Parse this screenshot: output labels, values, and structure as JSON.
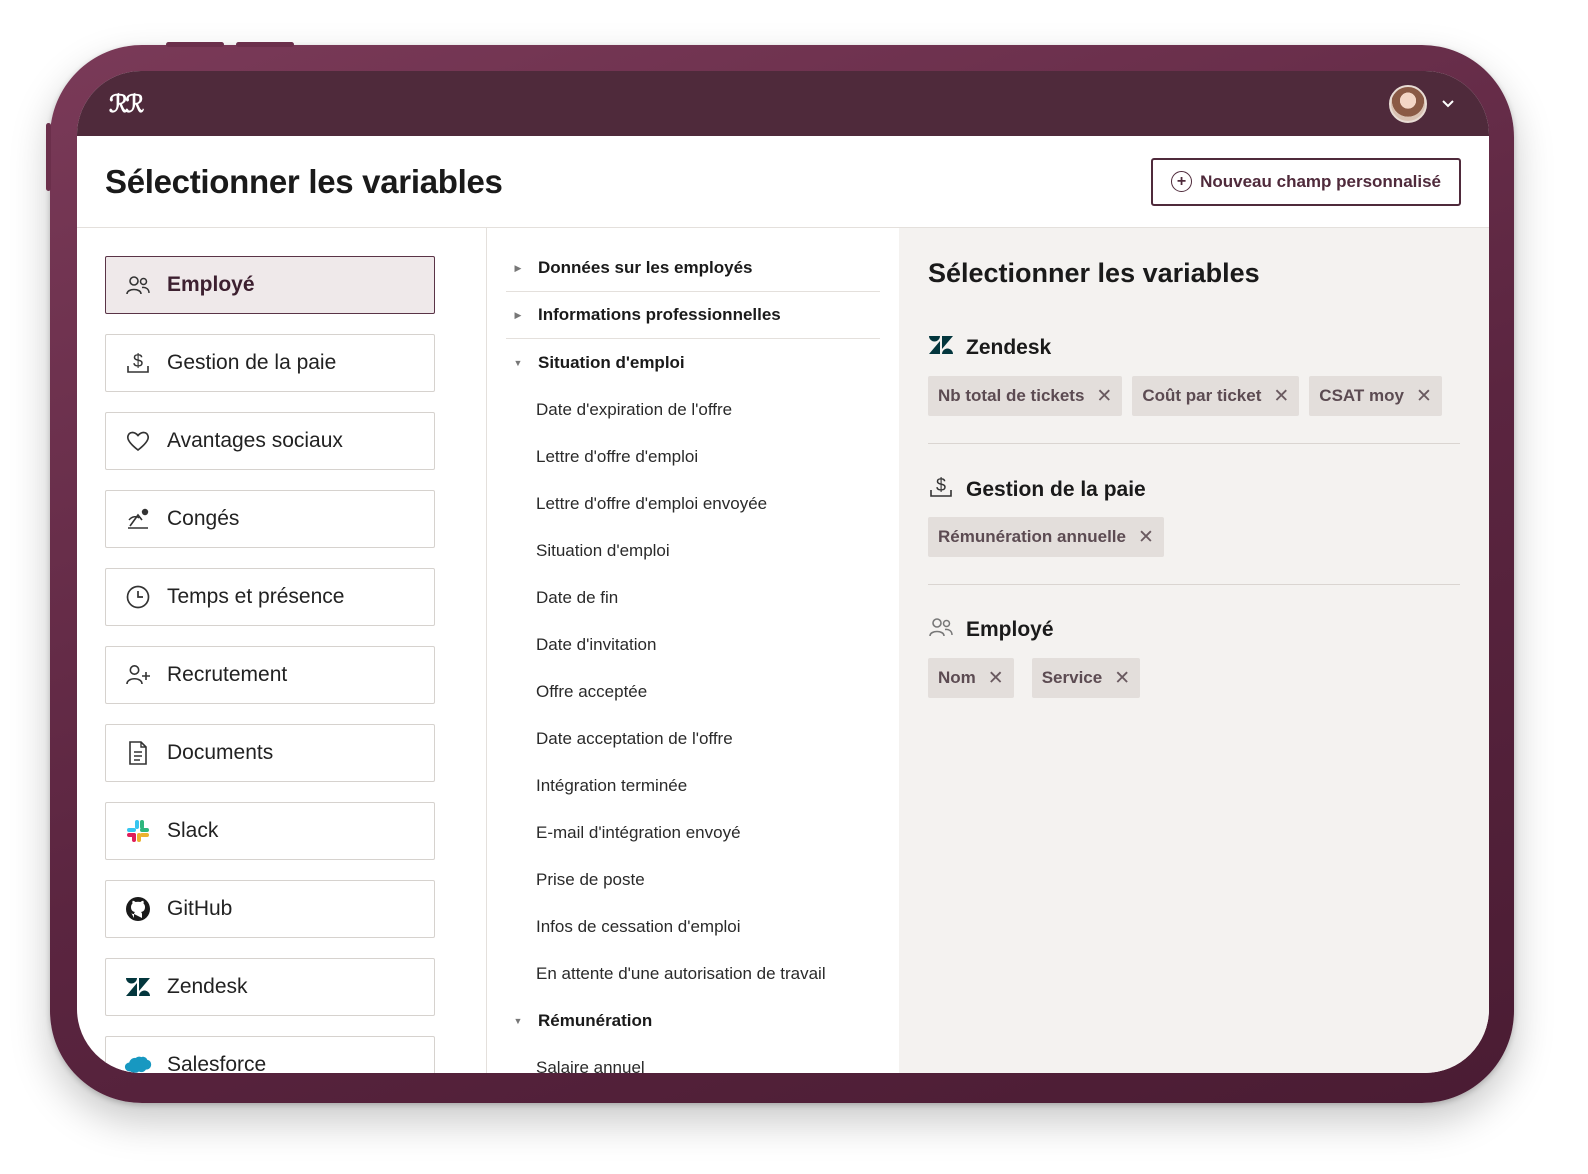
{
  "app": {
    "logo": "ℛℛ"
  },
  "header": {
    "title": "Sélectionner les variables",
    "new_field_label": "Nouveau champ personnalisé"
  },
  "categories": [
    {
      "label": "Employé",
      "icon": "people-icon"
    },
    {
      "label": "Gestion de la paie",
      "icon": "dollar-icon"
    },
    {
      "label": "Avantages sociaux",
      "icon": "heart-icon"
    },
    {
      "label": "Congés",
      "icon": "beach-icon"
    },
    {
      "label": "Temps et présence",
      "icon": "clock-icon"
    },
    {
      "label": "Recrutement",
      "icon": "user-plus-icon"
    },
    {
      "label": "Documents",
      "icon": "document-icon"
    },
    {
      "label": "Slack",
      "icon": "slack-icon"
    },
    {
      "label": "GitHub",
      "icon": "github-icon"
    },
    {
      "label": "Zendesk",
      "icon": "zendesk-icon"
    },
    {
      "label": "Salesforce",
      "icon": "salesforce-icon"
    }
  ],
  "fields": {
    "sections": [
      "Données sur les employés",
      "Informations professionnelles",
      "Situation d'emploi",
      "Rémunération"
    ],
    "employment_items": [
      "Date d'expiration de l'offre",
      "Lettre d'offre d'emploi",
      "Lettre d'offre d'emploi envoyée",
      "Situation d'emploi",
      "Date de fin",
      "Date d'invitation",
      "Offre acceptée",
      "Date acceptation de l'offre",
      "Intégration terminée",
      "E-mail d'intégration envoyé",
      "Prise de poste",
      "Infos de cessation d'emploi",
      "En attente d'une autorisation de travail"
    ],
    "compensation_items": [
      "Salaire annuel"
    ]
  },
  "selected": {
    "title": "Sélectionner les variables",
    "groups": [
      {
        "name": "Zendesk",
        "chips": [
          "Nb total de tickets",
          "Coût par ticket",
          "CSAT moy"
        ]
      },
      {
        "name": "Gestion de la paie",
        "chips": [
          "Rémunération annuelle"
        ]
      },
      {
        "name": "Employé",
        "chips": [
          "Nom",
          "Service"
        ]
      }
    ]
  },
  "colors": {
    "brand": "#4f2a3b",
    "device": "#5b2540",
    "chip_bg": "#e3dedb",
    "panel_bg": "#f4f2f0"
  }
}
